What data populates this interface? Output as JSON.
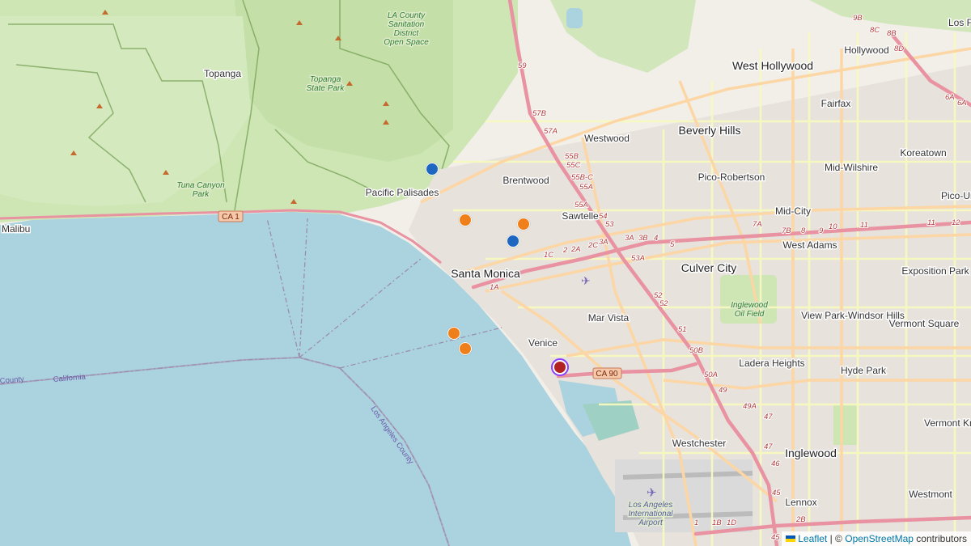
{
  "map": {
    "places": {
      "west_hollywood": "West Hollywood",
      "hollywood": "Hollywood",
      "los_feliz": "Los Fe",
      "fairfax": "Fairfax",
      "beverly_hills": "Beverly Hills",
      "koreatown": "Koreatown",
      "westwood": "Westwood",
      "brentwood": "Brentwood",
      "pico_robertson": "Pico-Robertson",
      "mid_wilshire": "Mid-Wilshire",
      "pico_union": "Pico-Un",
      "topanga": "Topanga",
      "pacific_palisades": "Pacific Palisades",
      "sawtelle": "Sawtelle",
      "mid_city": "Mid-City",
      "malibu": "Malibu",
      "west_adams": "West Adams",
      "santa_monica": "Santa Monica",
      "culver_city": "Culver City",
      "exposition_park": "Exposition Park",
      "mar_vista": "Mar Vista",
      "view_park": "View Park-Windsor Hills",
      "vermont_square": "Vermont Square",
      "venice": "Venice",
      "ladera_heights": "Ladera Heights",
      "hyde_park": "Hyde Park",
      "vermont_knolls": "Vermont Kn",
      "westchester": "Westchester",
      "inglewood": "Inglewood",
      "lennox": "Lennox",
      "westmont": "Westmont",
      "la_county_sanitation": "LA County Sanitation District Open Space",
      "topanga_state_park": "Topanga State Park",
      "tuna_canyon_park": "Tuna Canyon Park",
      "inglewood_oil_field": "Inglewood Oil Field",
      "lax": "Los Angeles International Airport",
      "california": "California",
      "county": "County",
      "la_county": "Los Angeles County"
    },
    "shields": {
      "ca1": "CA 1",
      "ca90": "CA 90"
    },
    "route_labels": [
      "59",
      "57B",
      "57A",
      "55B",
      "55C",
      "55B-C",
      "55A",
      "55A",
      "54",
      "53",
      "3A",
      "3B",
      "4",
      "5",
      "1C",
      "2",
      "2A",
      "2C",
      "3A",
      "1A",
      "53A",
      "52",
      "52",
      "51",
      "50B",
      "50A",
      "49",
      "49A",
      "47",
      "47",
      "46",
      "45",
      "1",
      "1B",
      "1D",
      "2B",
      "45",
      "7A",
      "7B",
      "8",
      "9",
      "10",
      "11",
      "11",
      "12",
      "9B",
      "8C",
      "8B",
      "8D",
      "6A",
      "6A"
    ],
    "markers": [
      {
        "name": "marker-blue-1",
        "color": "#1f66c1"
      },
      {
        "name": "marker-orange-1",
        "color": "#ef7f1a"
      },
      {
        "name": "marker-orange-2",
        "color": "#ef7f1a"
      },
      {
        "name": "marker-blue-2",
        "color": "#1f66c1"
      },
      {
        "name": "marker-orange-3",
        "color": "#ef7f1a"
      },
      {
        "name": "marker-orange-4",
        "color": "#ef7f1a"
      },
      {
        "name": "marker-selected-red",
        "color": "#b22222"
      }
    ],
    "colors": {
      "land": "#f2efe9",
      "water": "#aad3df",
      "park": "#cde6b4",
      "forest": "#b9d99a",
      "motorway": "#e892a2",
      "primary": "#fcd6a4",
      "secondary": "#f7fabf"
    }
  },
  "attribution": {
    "leaflet": "Leaflet",
    "separator": "| ©",
    "osm": "OpenStreetMap",
    "suffix": "contributors"
  }
}
